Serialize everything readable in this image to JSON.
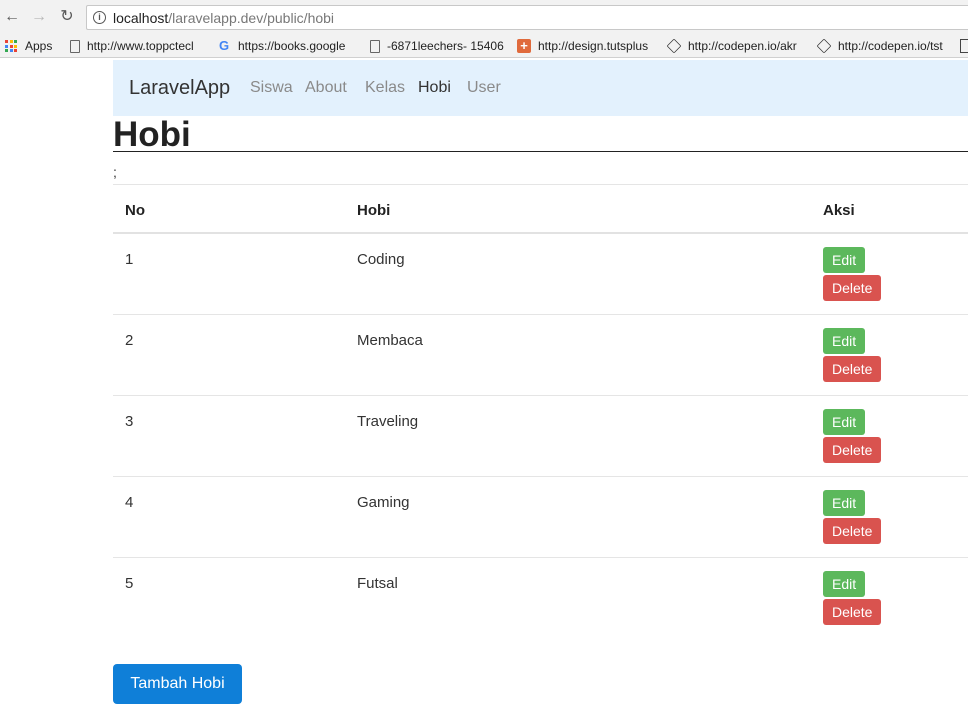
{
  "browser": {
    "back_glyph": "←",
    "forward_glyph": "→",
    "reload_glyph": "↻",
    "url_host": "localhost",
    "url_path": "/laravelapp.dev/public/hobi",
    "bookmarks": [
      {
        "label": "Apps",
        "icon": "apps-icon"
      },
      {
        "label": "http://www.toppctecl",
        "icon": "page-icon"
      },
      {
        "label": "https://books.google",
        "icon": "google-icon"
      },
      {
        "label": "-6871leechers- 15406",
        "icon": "page-icon"
      },
      {
        "label": "http://design.tutsplus",
        "icon": "tutsplus-icon"
      },
      {
        "label": "http://codepen.io/akr",
        "icon": "codepen-icon"
      },
      {
        "label": "http://codepen.io/tst",
        "icon": "codepen-icon"
      }
    ]
  },
  "navbar": {
    "brand": "LaravelApp",
    "links": [
      {
        "label": "Siswa",
        "active": false
      },
      {
        "label": "About",
        "active": false
      },
      {
        "label": "Kelas",
        "active": false
      },
      {
        "label": "Hobi",
        "active": true
      },
      {
        "label": "User",
        "active": false
      }
    ]
  },
  "page": {
    "title": "Hobi",
    "stray_text": ";"
  },
  "table": {
    "headers": {
      "no": "No",
      "hobi": "Hobi",
      "aksi": "Aksi"
    },
    "edit_label": "Edit",
    "delete_label": "Delete",
    "rows": [
      {
        "no": "1",
        "hobi": "Coding"
      },
      {
        "no": "2",
        "hobi": "Membaca"
      },
      {
        "no": "3",
        "hobi": "Traveling"
      },
      {
        "no": "4",
        "hobi": "Gaming"
      },
      {
        "no": "5",
        "hobi": "Futsal"
      }
    ]
  },
  "actions": {
    "add_label": "Tambah Hobi"
  },
  "colors": {
    "navbar_bg": "#e3f1fd",
    "edit_button": "#5cb85c",
    "delete_button": "#d9534f",
    "primary_button": "#0f7fd8"
  }
}
